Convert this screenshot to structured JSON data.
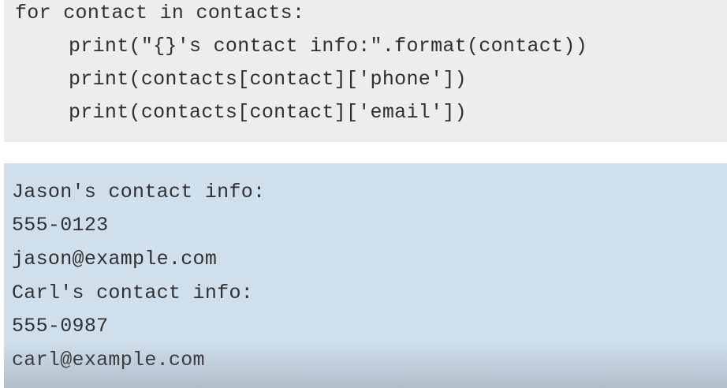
{
  "code": {
    "lines": [
      "for contact in contacts:",
      "print(\"{}'s contact info:\".format(contact))",
      "print(contacts[contact]['phone'])",
      "print(contacts[contact]['email'])"
    ]
  },
  "output": {
    "lines": [
      "Jason's contact info:",
      "555-0123",
      "jason@example.com",
      "Carl's contact info:",
      "555-0987",
      "carl@example.com"
    ]
  },
  "colors": {
    "code_background": "#ededed",
    "output_background": "#cfdfec",
    "text": "#2f2f2f"
  }
}
